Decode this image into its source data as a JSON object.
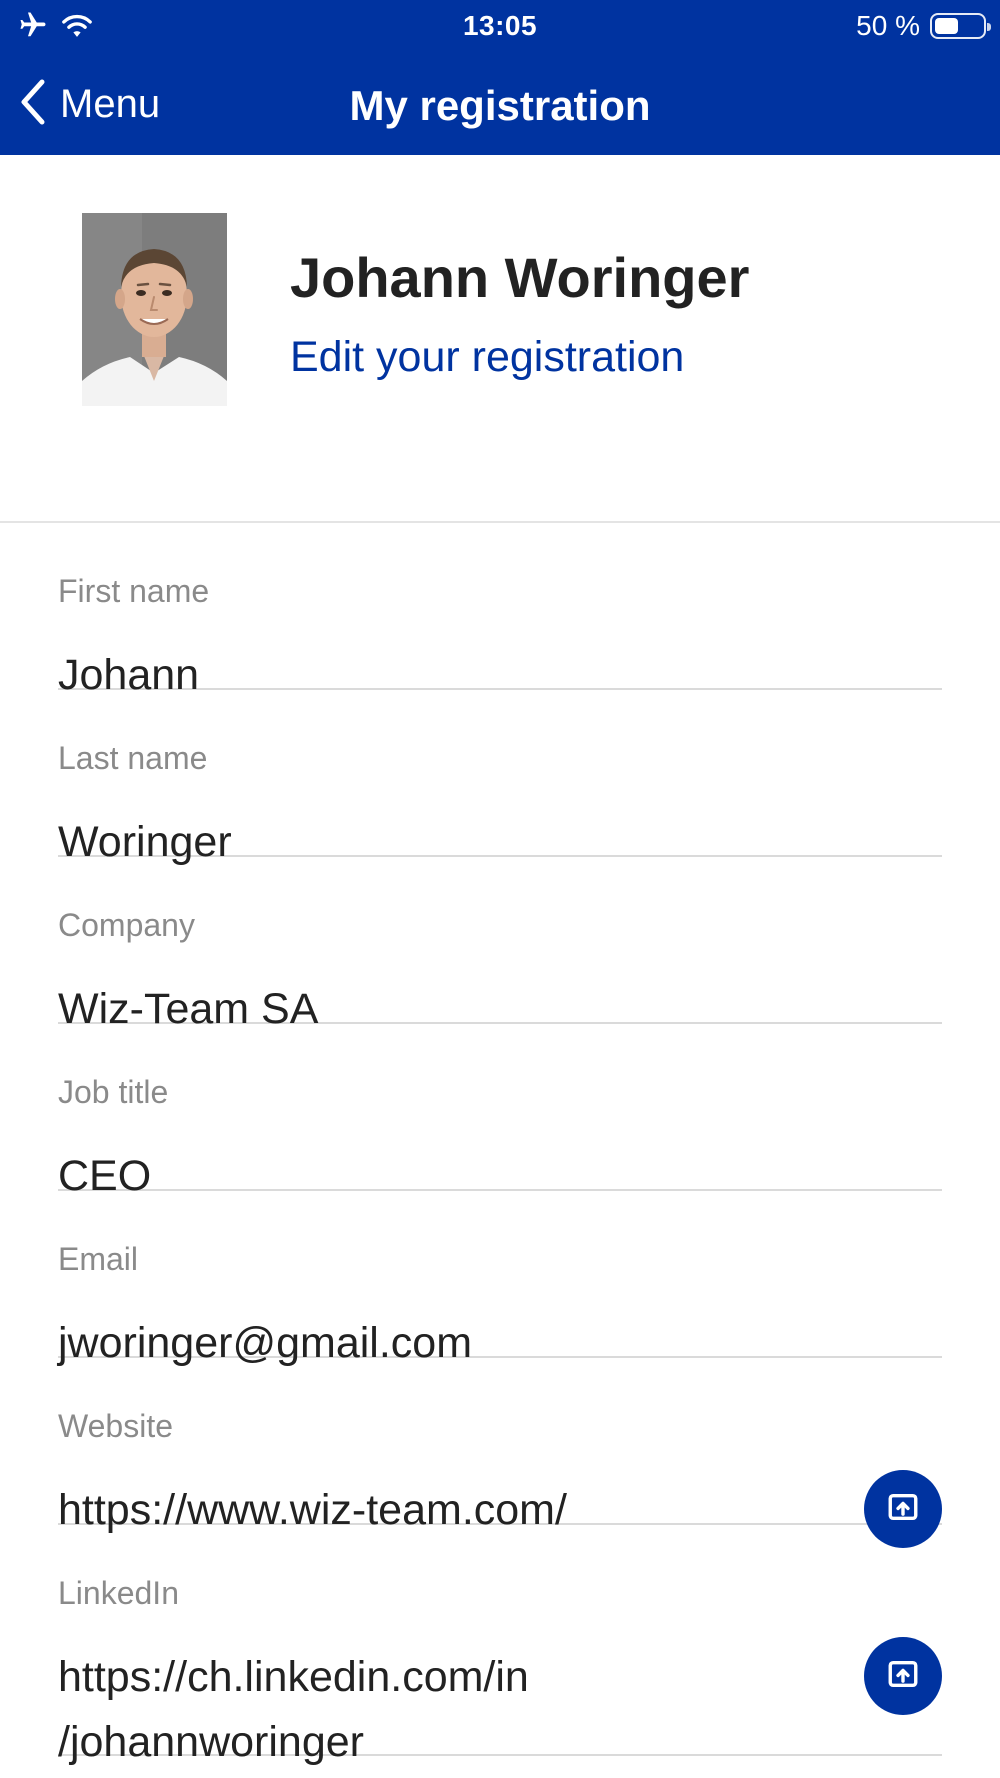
{
  "status_bar": {
    "time": "13:05",
    "battery_text": "50 %",
    "battery_level": 0.5,
    "icons": [
      "airplane-icon",
      "wifi-icon",
      "battery-icon"
    ]
  },
  "nav": {
    "back_label": "Menu",
    "title": "My registration"
  },
  "profile": {
    "name": "Johann Woringer",
    "edit_label": "Edit your registration"
  },
  "fields": {
    "first_name": {
      "label": "First name",
      "value": "Johann"
    },
    "last_name": {
      "label": "Last name",
      "value": "Woringer"
    },
    "company": {
      "label": "Company",
      "value": "Wiz-Team SA"
    },
    "job_title": {
      "label": "Job title",
      "value": "CEO"
    },
    "email": {
      "label": "Email",
      "value": "jworinger@gmail.com"
    },
    "website": {
      "label": "Website",
      "value": "https://www.wiz-team.com/"
    },
    "linkedin": {
      "label": "LinkedIn",
      "value_line1": "https://ch.linkedin.com/in",
      "value_line2": "/johannworinger"
    }
  },
  "colors": {
    "brand": "#0033a0",
    "label": "#8a8a8a",
    "text": "#222222",
    "divider": "#dadada"
  }
}
